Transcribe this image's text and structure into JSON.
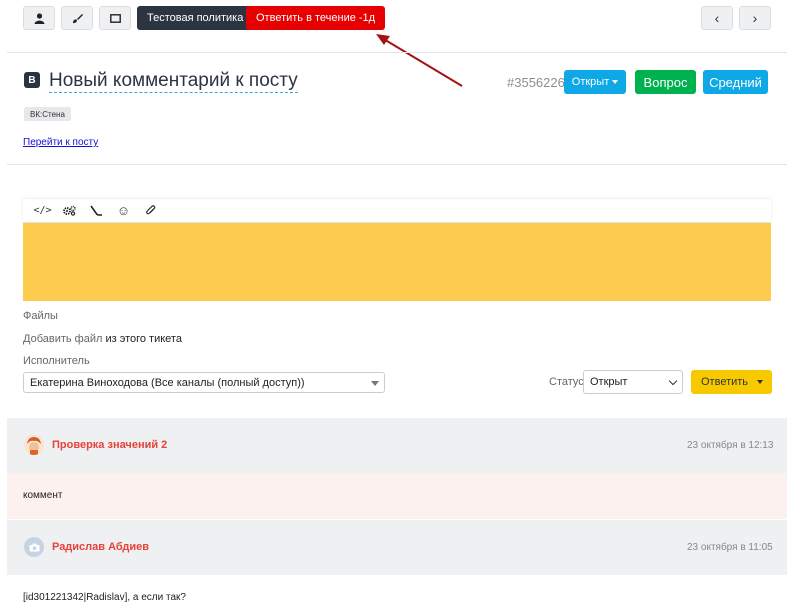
{
  "toolbar": {
    "icons": [
      "user-icon",
      "brush-icon",
      "tablet-icon"
    ],
    "policy_label": "Тестовая политика",
    "deadline_label": "Ответить в течение -1д",
    "nav_prev": "‹",
    "nav_next": "›"
  },
  "ticket": {
    "source_badge": "B",
    "title": "Новый комментарий к посту",
    "number": "#3556226",
    "status_button": "Открыт",
    "type_button": "Вопрос",
    "priority_button": "Средний",
    "channel_tag": "ВК:Стена",
    "post_link": "Перейти к посту"
  },
  "editor": {
    "tools": [
      "code-icon",
      "gears-icon",
      "pipe-icon",
      "smile-icon",
      "paperclip-icon"
    ],
    "code_glyph": "</>",
    "smile_glyph": "☺"
  },
  "form": {
    "files_label": "Файлы",
    "add_file_link": "Добавить файл",
    "add_file_suffix": " из этого тикета",
    "assignee_label": "Исполнитель",
    "assignee_value": "Екатерина Виноходова (Все каналы (полный доступ))",
    "status_label": "Статус",
    "status_value": "Открыт",
    "reply_button": "Ответить"
  },
  "comments": [
    {
      "author": "Проверка значений 2",
      "date": "23 октября в 12:13",
      "text": "коммент"
    },
    {
      "author": "Радислав Абдиев",
      "date": "23 октября в 11:05",
      "text": "[id301221342|Radislav], а если так?"
    }
  ],
  "colors": {
    "deadline": "#e60000",
    "status": "#0ea8e6",
    "type": "#00b14f",
    "priority": "#0ea8e6",
    "editor_bg": "#fdcc4e",
    "reply": "#f9c900",
    "author": "#e8403a"
  }
}
